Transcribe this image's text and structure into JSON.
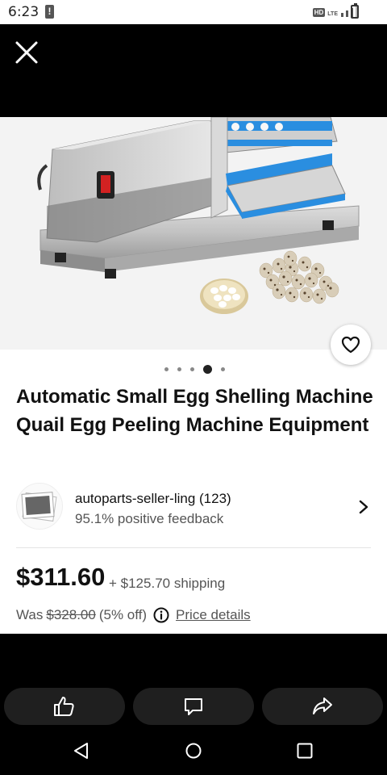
{
  "status_bar": {
    "time": "6:23",
    "alert_icon": "alert-icon",
    "network_badge": "HD",
    "network_type": "LTE"
  },
  "header": {
    "close_icon": "close-icon"
  },
  "gallery": {
    "image_count": 5,
    "active_index": 3,
    "favorite_icon": "heart-icon"
  },
  "listing": {
    "title": "Automatic Small Egg Shelling Machine Quail Egg Peeling Machine Equipment"
  },
  "seller": {
    "name": "autoparts-seller-ling (123)",
    "feedback": "95.1% positive feedback",
    "chevron_icon": "chevron-right-icon"
  },
  "pricing": {
    "price": "$311.60",
    "shipping": "+ $125.70 shipping",
    "was_label": "Was",
    "was_price": "$328.00",
    "discount": "(5% off)",
    "details_link": "Price details"
  },
  "actions": {
    "like_icon": "thumbs-up-icon",
    "comment_icon": "comment-icon",
    "share_icon": "share-icon"
  },
  "nav": {
    "back_icon": "back-icon",
    "home_icon": "home-icon",
    "recents_icon": "recents-icon"
  },
  "colors": {
    "background": "#000000",
    "surface": "#ffffff",
    "text_primary": "#111111",
    "text_secondary": "#555555",
    "action_button": "#1f1f1f",
    "machine_accent": "#2a8ee0"
  }
}
